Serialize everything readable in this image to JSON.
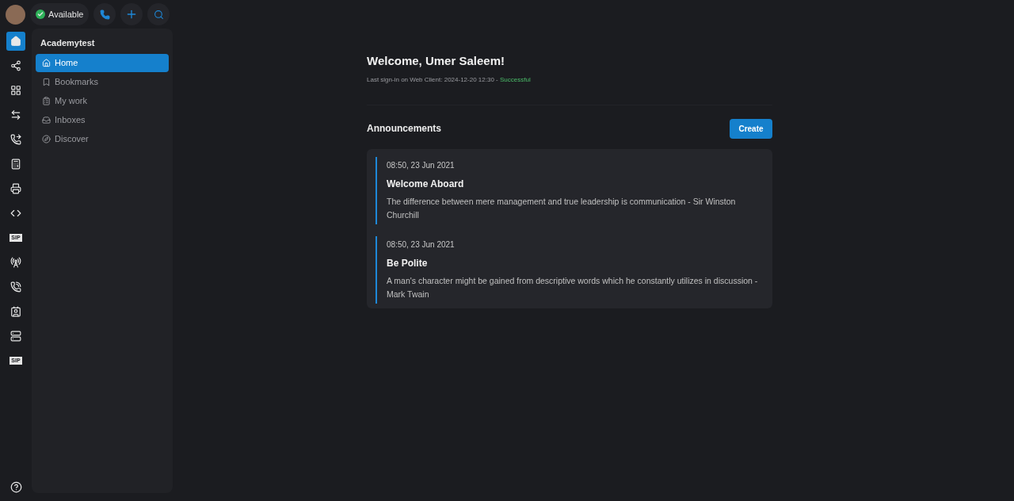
{
  "top_bar": {
    "status": {
      "label": "Available",
      "on": true
    }
  },
  "rail": [
    {
      "kind": "icon",
      "selected": true
    },
    {
      "kind": "icon",
      "selected": false
    },
    {
      "kind": "icon",
      "selected": false
    },
    {
      "kind": "icon",
      "selected": false
    },
    {
      "kind": "icon",
      "selected": false
    },
    {
      "kind": "icon",
      "selected": false
    },
    {
      "kind": "icon",
      "selected": false
    },
    {
      "kind": "icon",
      "selected": false
    },
    {
      "kind": "text",
      "label": "SIP",
      "selected": false
    },
    {
      "kind": "icon",
      "selected": false
    },
    {
      "kind": "icon",
      "selected": false
    },
    {
      "kind": "icon",
      "selected": false
    },
    {
      "kind": "icon",
      "selected": false
    },
    {
      "kind": "text",
      "label": "SIP",
      "selected": false
    }
  ],
  "sidebar": {
    "title": "Academytest",
    "items": [
      {
        "label": "Home",
        "selected": true
      },
      {
        "label": "Bookmarks",
        "selected": false
      },
      {
        "label": "My work",
        "selected": false
      },
      {
        "label": "Inboxes",
        "selected": false
      },
      {
        "label": "Discover",
        "selected": false
      }
    ]
  },
  "welcome": {
    "title": "Welcome, Umer Saleem!",
    "last_sign_in": "Last sign-in on Web Client: 2024-12-20 12:30 -",
    "result": "Successful"
  },
  "announcements": {
    "title": "Announcements",
    "button": "Create",
    "items": [
      {
        "time": "08:50, 23 Jun 2021",
        "title": "Welcome Aboard",
        "body": "The difference between mere management and true leadership is communication - Sir Winston Churchill"
      },
      {
        "time": "08:50, 23 Jun 2021",
        "title": "Be Polite",
        "body": "A man's character might be gained from descriptive words which he constantly utilizes in discussion - Mark Twain"
      }
    ]
  }
}
